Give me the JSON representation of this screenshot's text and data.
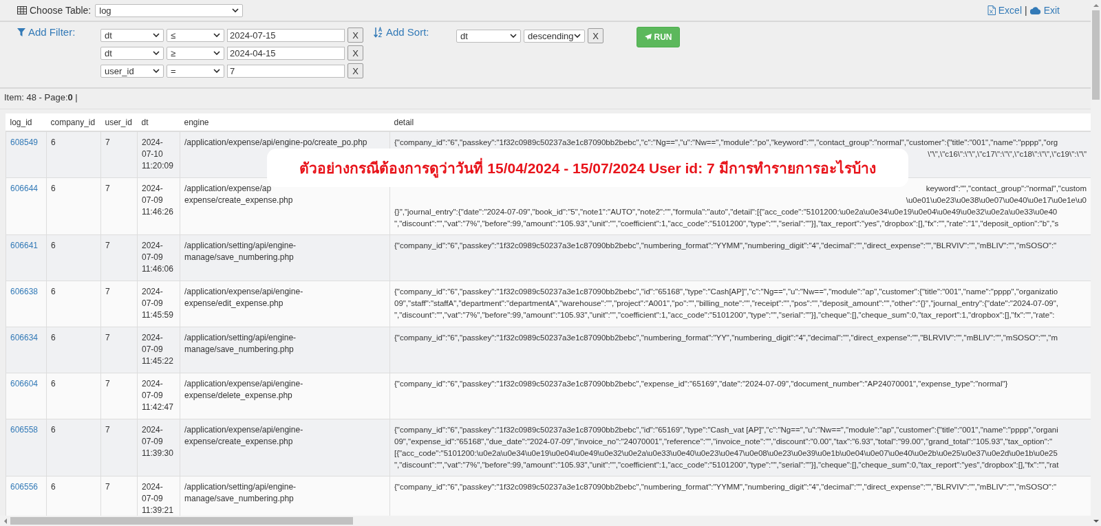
{
  "toolbar": {
    "table_label": "Choose Table:",
    "table": "log",
    "excel": "Excel",
    "separator": "|",
    "exit": "Exit"
  },
  "filter": {
    "label": "Add Filter:",
    "rows": [
      {
        "field": "dt",
        "op": "≤",
        "value": "2024-07-15",
        "remove": "X"
      },
      {
        "field": "dt",
        "op": "≥",
        "value": "2024-04-15",
        "remove": "X"
      },
      {
        "field": "user_id",
        "op": "=",
        "value": "7",
        "remove": "X"
      }
    ]
  },
  "sort": {
    "label": "Add Sort:",
    "field": "dt",
    "order": "descending",
    "remove": "X"
  },
  "run": "RUN",
  "summary": {
    "items": "Item: 48 - Page:",
    "page": "0",
    "tail": "|"
  },
  "table": {
    "columns": [
      "log_id",
      "company_id",
      "user_id",
      "dt",
      "engine",
      "detail"
    ],
    "rows": [
      {
        "log_id": "608549",
        "company_id": "6",
        "user_id": "7",
        "dt": "2024-07-10 11:20:09",
        "engine": "/application/expense/api/engine-po/create_po.php",
        "detail": [
          {
            "kind": "line",
            "text": "{\"company_id\":\"6\",\"passkey\":\"1f32c0989c50237a3e1c87090bb2bebc\",\"c\":\"Ng==\",\"u\":\"Nw==\",\"module\":\"po\",\"keyword\":\"\",\"contact_group\":\"normal\",\"customer\":{\"title\":\"001\",\"name\":\"pppp\",\"org"
          },
          {
            "kind": "tail",
            "text": "\\\"\\\",\\\"c16\\\":\\\"\\\",\\\"c17\\\":\\\"\\\",\\\"c18\\\":\\\"\\\",\\\"c19\\\":\\\"\\\""
          }
        ]
      },
      {
        "log_id": "606644",
        "company_id": "6",
        "user_id": "7",
        "dt": "2024-07-09 11:46:26",
        "engine": [
          "/application/expense/ap",
          "expense/create_expense.php"
        ],
        "detail": [
          {
            "kind": "tail",
            "text": "keyword\":\"\",\"contact_group\":\"normal\",\"custom"
          },
          {
            "kind": "tail",
            "text": "\\u0e01\\u0e23\\u0e38\\u0e07\\u0e40\\u0e17\\u0e1e\\u0"
          },
          {
            "kind": "line",
            "text": "{}\",\"journal_entry\":{\"date\":\"2024-07-09\",\"book_id\":\"5\",\"note1\":\"AUTO\",\"note2\":\"\",\"formula\":\"auto\",\"detail\":[{\"acc_code\":\"5101200:\\u0e2a\\u0e34\\u0e19\\u0e04\\u0e49\\u0e32\\u0e2a\\u0e33\\u0e40"
          },
          {
            "kind": "line",
            "text": "\",\"discount\":\"\",\"vat\":\"7%\",\"before\":99,\"amount\":\"105.93\",\"unit\":\"\",\"coefficient\":1,\"acc_code\":\"5101200\",\"type\":\"\",\"serial\":\"\"}],\"tax_report\":\"yes\",\"dropbox\":[],\"fx\":\"\",\"rate\":\"1\",\"deposit_option\":\"b\",\"s"
          }
        ]
      },
      {
        "log_id": "606641",
        "company_id": "6",
        "user_id": "7",
        "dt": "2024-07-09 11:46:06",
        "engine": "/application/setting/api/engine-manage/save_numbering.php",
        "detail": [
          {
            "kind": "line",
            "text": "{\"company_id\":\"6\",\"passkey\":\"1f32c0989c50237a3e1c87090bb2bebc\",\"numbering_format\":\"YYMM\",\"numbering_digit\":\"4\",\"decimal\":\"\",\"direct_expense\":\"\",\"BLRVIV\":\"\",\"mBLIV\":\"\",\"mSOSO\":\""
          }
        ]
      },
      {
        "log_id": "606638",
        "company_id": "6",
        "user_id": "7",
        "dt": "2024-07-09 11:45:59",
        "engine": "/application/expense/api/engine-expense/edit_expense.php",
        "detail": [
          {
            "kind": "line",
            "text": "{\"company_id\":\"6\",\"passkey\":\"1f32c0989c50237a3e1c87090bb2bebc\",\"id\":\"65168\",\"type\":\"Cash[AP]\",\"c\":\"Ng==\",\"u\":\"Nw==\",\"module\":\"ap\",\"customer\":{\"title\":\"001\",\"name\":\"pppp\",\"organizatio"
          },
          {
            "kind": "line",
            "text": "09\",\"staff\":\"staffA\",\"department\":\"departmentA\",\"warehouse\":\"\",\"project\":\"A001\",\"po\":\"\",\"billing_note\":\"\",\"receipt\":\"\",\"pos\":\"\",\"deposit_amount\":\"\",\"other\":\"{}\",\"journal_entry\":{\"date\":\"2024-07-09\","
          },
          {
            "kind": "line",
            "text": "\",\"discount\":\"\",\"vat\":\"7%\",\"before\":99,\"amount\":\"105.93\",\"unit\":\"\",\"coefficient\":1,\"acc_code\":\"5101200\",\"type\":\"\",\"serial\":\"\"}],\"cheque\":[],\"cheque_sum\":0,\"tax_report\":1,\"dropbox\":[],\"fx\":\"\",\"rate\":"
          }
        ]
      },
      {
        "log_id": "606634",
        "company_id": "6",
        "user_id": "7",
        "dt": "2024-07-09 11:45:22",
        "engine": "/application/setting/api/engine-manage/save_numbering.php",
        "detail": [
          {
            "kind": "line",
            "text": "{\"company_id\":\"6\",\"passkey\":\"1f32c0989c50237a3e1c87090bb2bebc\",\"numbering_format\":\"YY\",\"numbering_digit\":\"4\",\"decimal\":\"\",\"direct_expense\":\"\",\"BLRVIV\":\"\",\"mBLIV\":\"\",\"mSOSO\":\"\",\"m"
          }
        ]
      },
      {
        "log_id": "606604",
        "company_id": "6",
        "user_id": "7",
        "dt": "2024-07-09 11:42:47",
        "engine": "/application/expense/api/engine-expense/delete_expense.php",
        "detail": [
          {
            "kind": "line",
            "text": "{\"company_id\":\"6\",\"passkey\":\"1f32c0989c50237a3e1c87090bb2bebc\",\"expense_id\":\"65169\",\"date\":\"2024-07-09\",\"document_number\":\"AP24070001\",\"expense_type\":\"normal\"}"
          }
        ]
      },
      {
        "log_id": "606558",
        "company_id": "6",
        "user_id": "7",
        "dt": "2024-07-09 11:39:30",
        "engine": "/application/expense/api/engine-expense/create_expense.php",
        "detail": [
          {
            "kind": "line",
            "text": "{\"company_id\":\"6\",\"passkey\":\"1f32c0989c50237a3e1c87090bb2bebc\",\"id\":\"65169\",\"type\":\"Cash_vat [AP]\",\"c\":\"Ng==\",\"u\":\"Nw==\",\"module\":\"ap\",\"customer\":{\"title\":\"001\",\"name\":\"pppp\",\"organi"
          },
          {
            "kind": "line",
            "text": "09\",\"expense_id\":\"65168\",\"due_date\":\"2024-07-09\",\"invoice_no\":\"24070001\",\"reference\":\"\",\"invoice_note\":\"\",\"discount\":\"0.00\",\"tax\":\"6.93\",\"total\":\"99.00\",\"grand_total\":\"105.93\",\"tax_option\":\""
          },
          {
            "kind": "line",
            "text": "[{\"acc_code\":\"5101200:\\u0e2a\\u0e34\\u0e19\\u0e04\\u0e49\\u0e32\\u0e2a\\u0e33\\u0e40\\u0e23\\u0e47\\u0e08\\u0e23\\u0e39\\u0e1b\\u0e04\\u0e07\\u0e40\\u0e2b\\u0e25\\u0e37\\u0e2d\\u0e1b\\u0e25"
          },
          {
            "kind": "line",
            "text": "\",\"discount\":\"\",\"vat\":\"7%\",\"before\":99,\"amount\":\"105.93\",\"unit\":\"\",\"coefficient\":1,\"acc_code\":\"5101200\",\"type\":\"\",\"serial\":\"\"}],\"cheque\":[],\"cheque_sum\":0,\"tax_report\":\"yes\",\"dropbox\":[],\"fx\":\"\",\"rat"
          }
        ]
      },
      {
        "log_id": "606556",
        "company_id": "6",
        "user_id": "7",
        "dt": "2024-07-09 11:39:21",
        "engine": "/application/setting/api/engine-manage/save_numbering.php",
        "detail": [
          {
            "kind": "line",
            "text": "{\"company_id\":\"6\",\"passkey\":\"1f32c0989c50237a3e1c87090bb2bebc\",\"numbering_format\":\"YYMM\",\"numbering_digit\":\"4\",\"decimal\":\"\",\"direct_expense\":\"\",\"BLRVIV\":\"\",\"mBLIV\":\"\",\"mSOSO\":\""
          }
        ]
      }
    ]
  },
  "banner": "ตัวอย่างกรณีต้องการดูว่าวันที่ 15/04/2024 - 15/07/2024 User id: 7  มีการทำรายการอะไรบ้าง"
}
